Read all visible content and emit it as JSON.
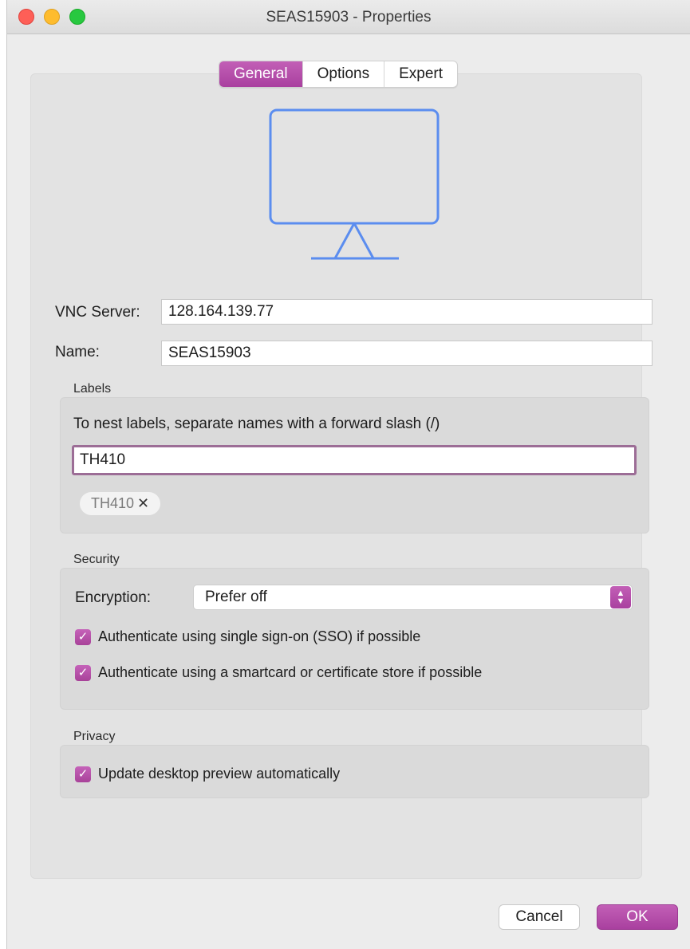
{
  "window": {
    "title": "SEAS15903 - Properties"
  },
  "tabs": [
    {
      "label": "General",
      "active": true
    },
    {
      "label": "Options",
      "active": false
    },
    {
      "label": "Expert",
      "active": false
    }
  ],
  "preview": {
    "icon": "monitor-icon",
    "stroke_color": "#5b8def"
  },
  "general": {
    "vnc_server_label": "VNC Server:",
    "vnc_server_value": "128.164.139.77",
    "name_label": "Name:",
    "name_value": "SEAS15903"
  },
  "labels": {
    "section_title": "Labels",
    "hint": "To nest labels, separate names with a forward slash (/)",
    "input_value": "TH410",
    "chips": [
      {
        "text": "TH410",
        "remove_glyph": "✕"
      }
    ]
  },
  "security": {
    "section_title": "Security",
    "encryption_label": "Encryption:",
    "encryption_value": "Prefer off",
    "options": [
      {
        "label": "Authenticate using single sign-on (SSO) if possible",
        "checked": true
      },
      {
        "label": "Authenticate using a smartcard or certificate store if possible",
        "checked": true
      }
    ]
  },
  "privacy": {
    "section_title": "Privacy",
    "options": [
      {
        "label": "Update desktop preview automatically",
        "checked": true
      }
    ]
  },
  "footer": {
    "cancel_label": "Cancel",
    "ok_label": "OK"
  },
  "colors": {
    "accent": "#b14fa6",
    "window_bg": "#ececec",
    "group_bg": "#dadada"
  }
}
